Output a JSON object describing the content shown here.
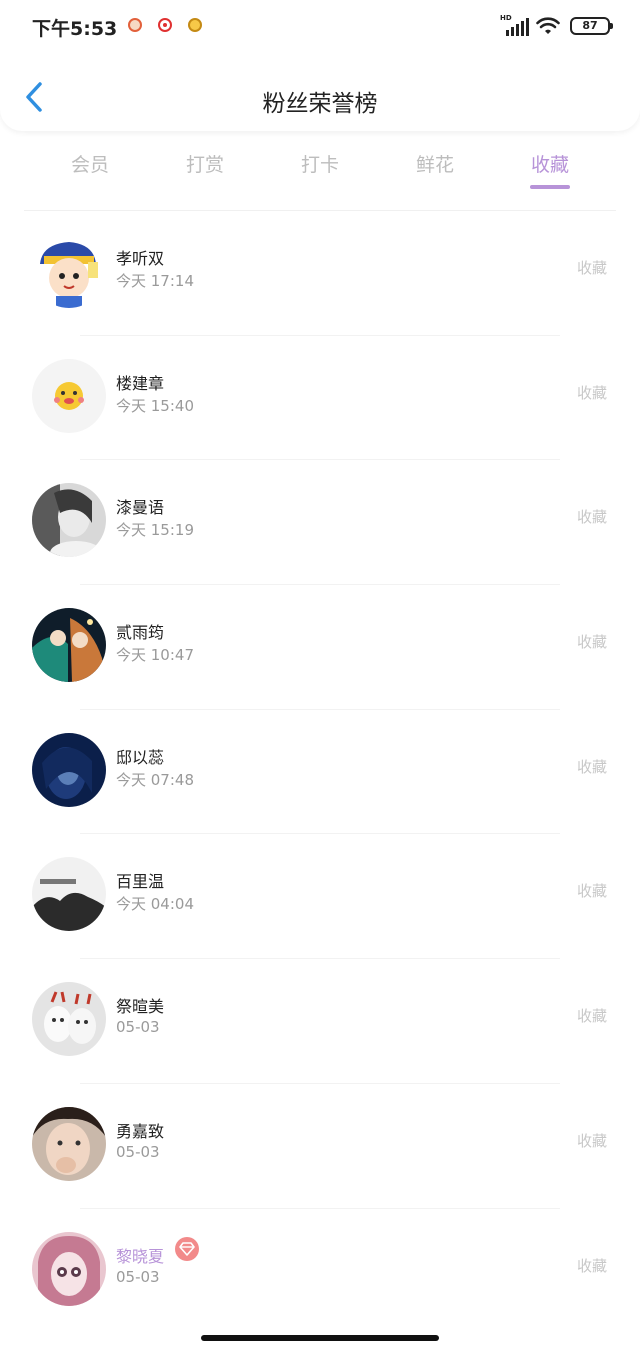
{
  "status": {
    "time": "下午5:53",
    "hd_label": "HD",
    "battery": "87"
  },
  "header": {
    "title": "粉丝荣誉榜"
  },
  "tabs": [
    {
      "label": "会员"
    },
    {
      "label": "打赏"
    },
    {
      "label": "打卡"
    },
    {
      "label": "鲜花"
    },
    {
      "label": "收藏"
    }
  ],
  "active_tab": "收藏",
  "colors": {
    "accent": "#b793d8",
    "back_arrow": "#2f8fe0",
    "vip_badge": "#f28a8a"
  },
  "rows": [
    {
      "name": "孝听双",
      "time": "今天 17:14",
      "action": "收藏"
    },
    {
      "name": "楼建章",
      "time": "今天 15:40",
      "action": "收藏"
    },
    {
      "name": "漆曼语",
      "time": "今天 15:19",
      "action": "收藏"
    },
    {
      "name": "贰雨筠",
      "time": "今天 10:47",
      "action": "收藏"
    },
    {
      "name": "邸以蕊",
      "time": "今天 07:48",
      "action": "收藏"
    },
    {
      "name": "百里温",
      "time": "今天 04:04",
      "action": "收藏"
    },
    {
      "name": "祭暄美",
      "time": "05-03",
      "action": "收藏"
    },
    {
      "name": "勇嘉致",
      "time": "05-03",
      "action": "收藏"
    },
    {
      "name": "黎晓夏",
      "time": "05-03",
      "action": "收藏",
      "vip": true
    }
  ]
}
